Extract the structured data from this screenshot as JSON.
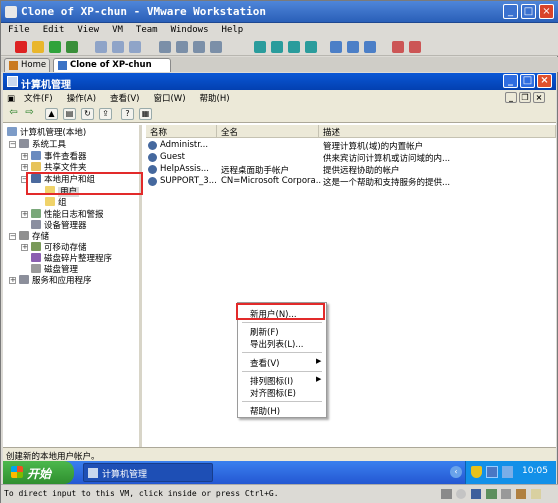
{
  "vmware": {
    "window_title": "Clone of XP-chun - VMware Workstation",
    "menu": [
      "File",
      "Edit",
      "View",
      "VM",
      "Team",
      "Windows",
      "Help"
    ],
    "tabs": [
      "Home",
      "Clone of XP-chun"
    ],
    "status_text": "To direct input to this VM, click inside or press Ctrl+G."
  },
  "app": {
    "title": "计算机管理",
    "menu": [
      "文件(F)",
      "操作(A)",
      "查看(V)",
      "窗口(W)",
      "帮助(H)"
    ],
    "status_text": "创建新的本地用户帐户。"
  },
  "tree": {
    "root": "计算机管理(本地)",
    "system_tools": "系统工具",
    "event_viewer": "事件查看器",
    "shared_folders": "共享文件夹",
    "local_users_groups": "本地用户和组",
    "users": "用户",
    "groups": "组",
    "perf_logs": "性能日志和警报",
    "device_manager": "设备管理器",
    "storage": "存储",
    "removable_storage": "可移动存储",
    "defrag": "磁盘碎片整理程序",
    "disk_mgmt": "磁盘管理",
    "services_apps": "服务和应用程序"
  },
  "list": {
    "columns": [
      "名称",
      "全名",
      "描述"
    ],
    "rows": [
      {
        "name": "Administr...",
        "fullname": "",
        "desc": "管理计算机(域)的内置帐户"
      },
      {
        "name": "Guest",
        "fullname": "",
        "desc": "供来宾访问计算机或访问域的内..."
      },
      {
        "name": "HelpAssis...",
        "fullname": "远程桌面助手帐户",
        "desc": "提供远程协助的帐户"
      },
      {
        "name": "SUPPORT_3...",
        "fullname": "CN=Microsoft Corpora...",
        "desc": "这是一个帮助和支持服务的提供..."
      }
    ]
  },
  "context_menu": {
    "new_user": "新用户(N)...",
    "refresh": "刷新(F)",
    "export": "导出列表(L)...",
    "view": "查看(V)",
    "arrange": "排列图标(I)",
    "lineup": "对齐图标(E)",
    "help": "帮助(H)"
  },
  "taskbar": {
    "start": "开始",
    "task": "计算机管理",
    "clock": "10:05"
  },
  "colors": {
    "xp_blue": "#0a57d6",
    "highlight_red": "#e22a2a",
    "start_green": "#3a9e3a"
  }
}
